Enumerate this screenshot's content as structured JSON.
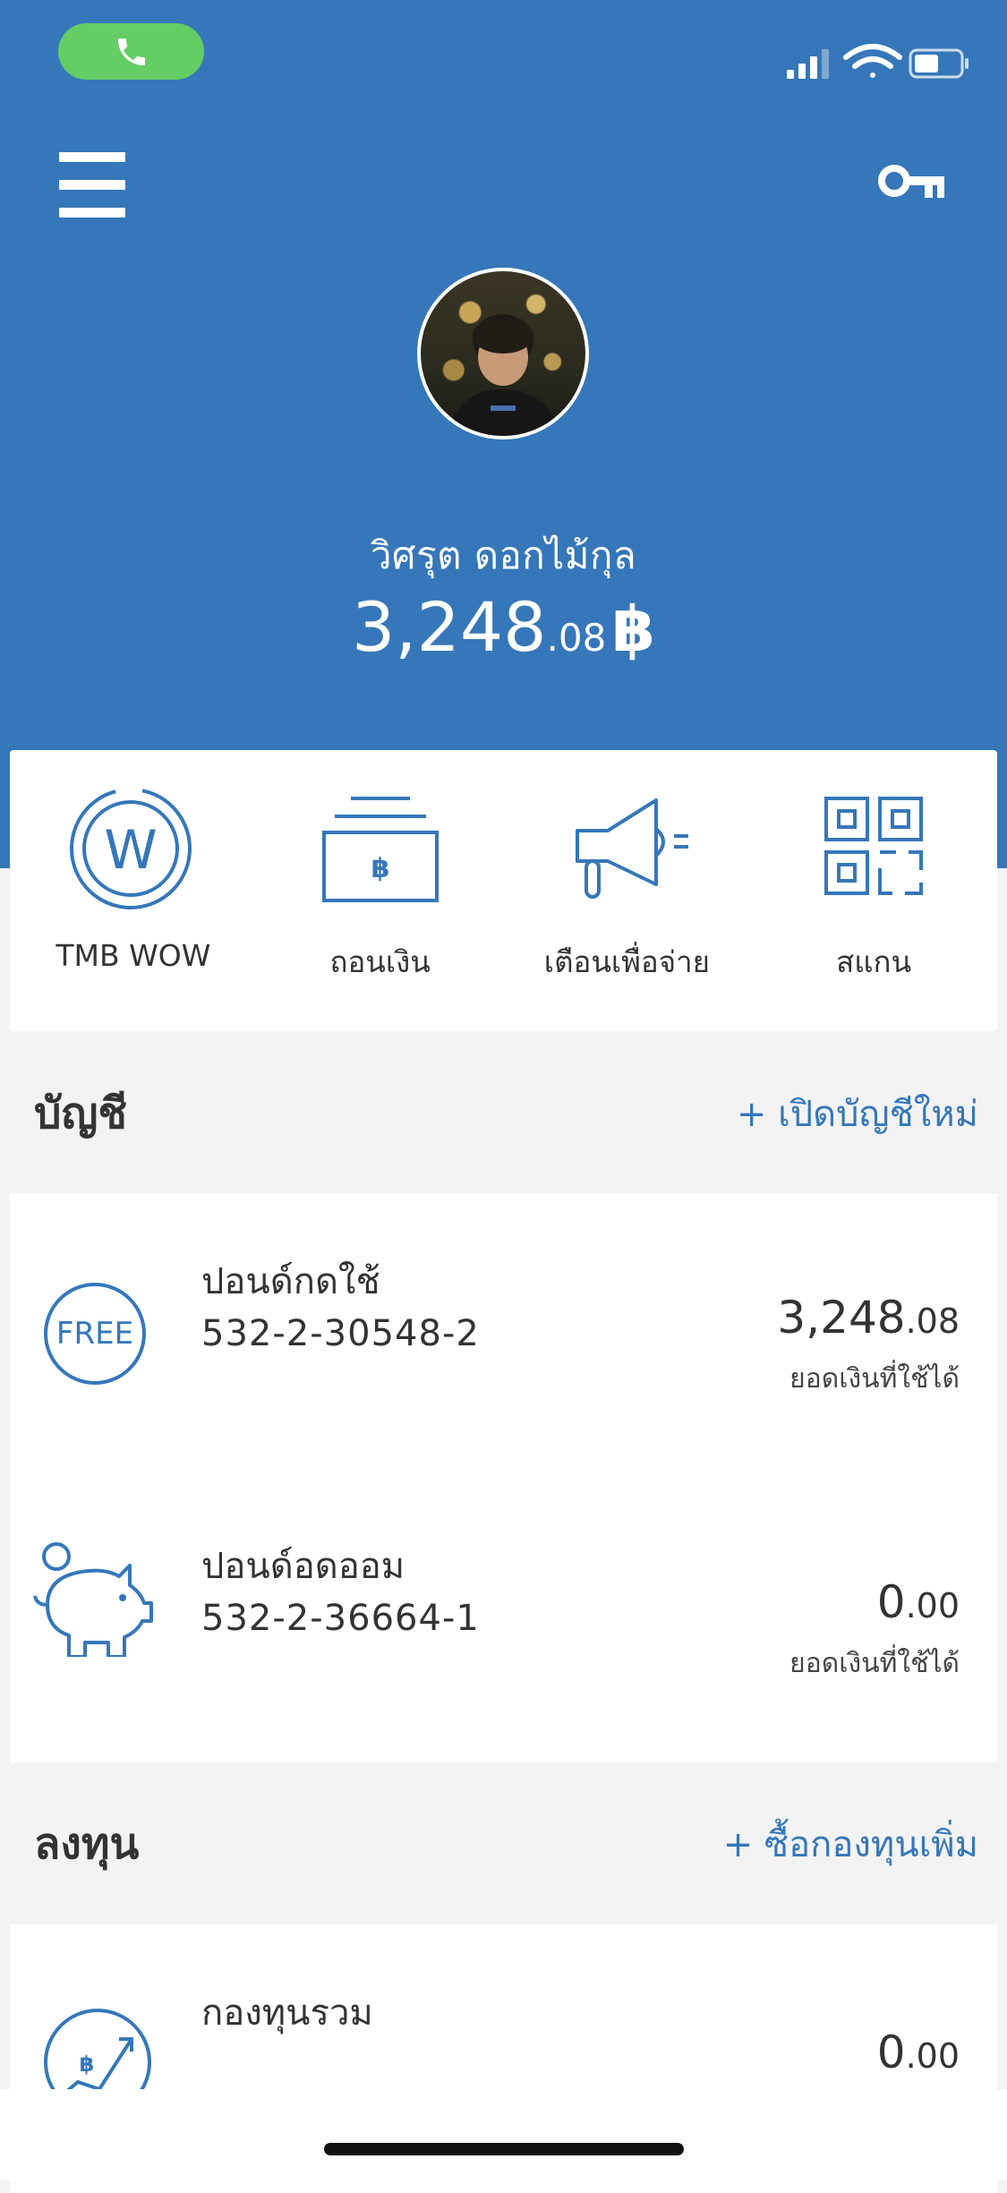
{
  "status_bar": {
    "call_icon": "phone-icon"
  },
  "header": {
    "menu_icon": "hamburger-menu-icon",
    "key_icon": "key-icon",
    "user_name": "วิศรุต  ดอกไม้กุล",
    "balance_main": "3,248",
    "balance_decimal": ".08",
    "currency": "฿"
  },
  "quick_actions": [
    {
      "label": "TMB WOW",
      "icon": "tmb-wow-icon"
    },
    {
      "label": "ถอนเงิน",
      "icon": "withdraw-cash-icon"
    },
    {
      "label": "เตือนเพื่อจ่าย",
      "icon": "megaphone-icon"
    },
    {
      "label": "สแกน",
      "icon": "qr-scan-icon"
    }
  ],
  "accounts_section": {
    "title": "บัญชี",
    "link": "+ เปิดบัญชีใหม่",
    "items": [
      {
        "name": "ปอนด์กดใช้",
        "number": "532-2-30548-2",
        "amount_main": "3,248",
        "amount_decimal": ".08",
        "sub": "ยอดเงินที่ใช้ได้",
        "icon_text": "FREE"
      },
      {
        "name": "ปอนด์อดออม",
        "number": "532-2-36664-1",
        "amount_main": "0",
        "amount_decimal": ".00",
        "sub": "ยอดเงินที่ใช้ได้",
        "icon": "piggy-bank-icon"
      }
    ]
  },
  "invest_section": {
    "title": "ลงทุน",
    "link": "+ ซื้อกองทุนเพิ่ม",
    "items": [
      {
        "name": "กองทุนรวม",
        "amount_main": "0",
        "amount_decimal": ".00",
        "icon": "fund-growth-icon"
      }
    ]
  },
  "colors": {
    "brand_blue": "#3577b9",
    "call_green": "#64cd64"
  }
}
